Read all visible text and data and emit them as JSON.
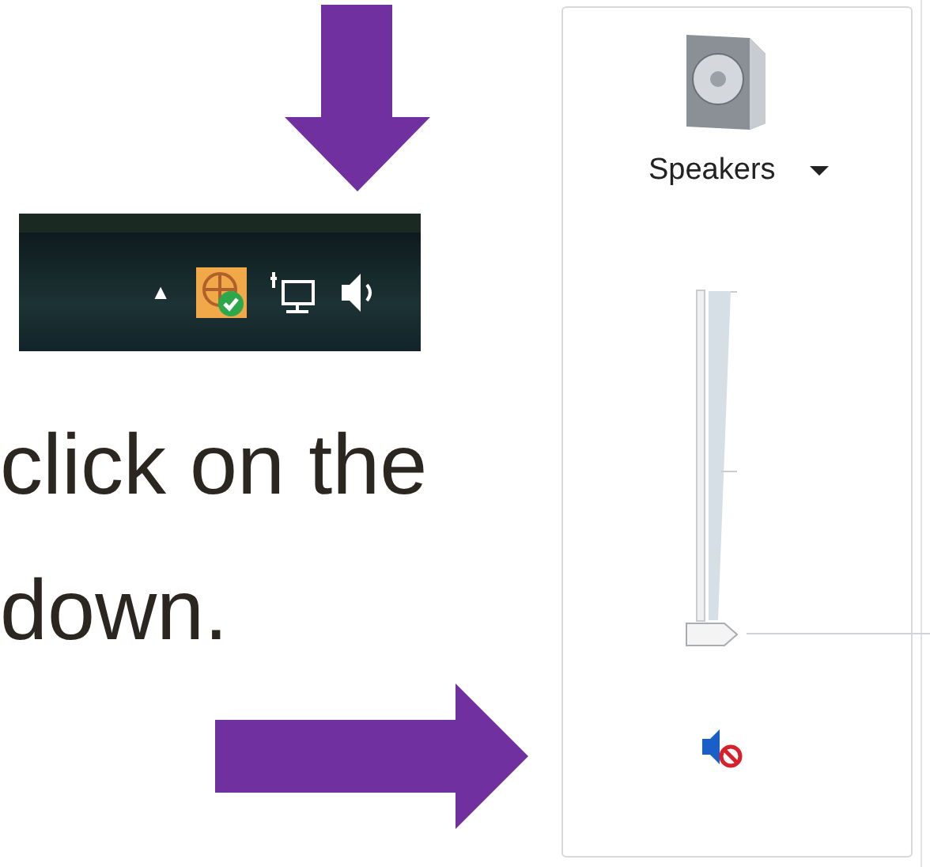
{
  "instruction_lines": [
    "click on the",
    "down."
  ],
  "taskbar": {
    "overflow_glyph": "▲"
  },
  "volume_mixer": {
    "device": "Speakers",
    "level": 0,
    "muted": true
  }
}
